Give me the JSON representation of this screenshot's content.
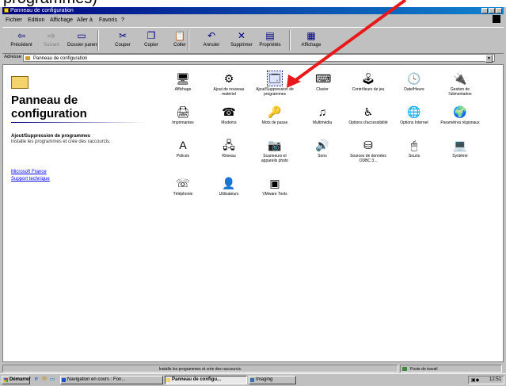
{
  "caption_fragment": "programmes)",
  "window": {
    "title": "Panneau de configuration"
  },
  "menu": [
    "Fichier",
    "Edition",
    "Affichage",
    "Aller à",
    "Favoris",
    "?"
  ],
  "toolbar": [
    {
      "label": "Précédent",
      "icon": "back-arrow-icon",
      "glyph": "⇦"
    },
    {
      "label": "Suivant",
      "icon": "forward-arrow-icon",
      "glyph": "⇨"
    },
    {
      "label": "Dossier parent",
      "icon": "up-folder-icon",
      "glyph": "▭"
    },
    {
      "label": "Couper",
      "icon": "scissors-icon",
      "glyph": "✂"
    },
    {
      "label": "Copier",
      "icon": "copy-icon",
      "glyph": "❐"
    },
    {
      "label": "Coller",
      "icon": "paste-icon",
      "glyph": "📋"
    },
    {
      "label": "Annuler",
      "icon": "undo-icon",
      "glyph": "↶"
    },
    {
      "label": "Supprimer",
      "icon": "delete-icon",
      "glyph": "✕"
    },
    {
      "label": "Propriétés",
      "icon": "properties-icon",
      "glyph": "▤"
    },
    {
      "label": "Affichage",
      "icon": "views-icon",
      "glyph": "▦"
    }
  ],
  "address": {
    "label": "Adresse",
    "value": "Panneau de configuration"
  },
  "left_pane": {
    "title": "Panneau de configuration",
    "selected_heading": "Ajout/Suppression de programmes",
    "selected_desc": "Installe les programmes et crée des raccourcis.",
    "links": [
      "Microsoft France",
      "Support technique"
    ]
  },
  "icons": [
    {
      "label": "Affichage",
      "icon": "display-icon",
      "glyph": "🖥"
    },
    {
      "label": "Ajout de nouveau matériel",
      "icon": "add-hardware-icon",
      "glyph": "⚙"
    },
    {
      "label": "Ajout/Suppression de programmes",
      "icon": "add-remove-programs-icon",
      "glyph": "🗔",
      "selected": true
    },
    {
      "label": "Clavier",
      "icon": "keyboard-icon",
      "glyph": "⌨"
    },
    {
      "label": "Contrôleurs de jeu",
      "icon": "game-controllers-icon",
      "glyph": "🕹"
    },
    {
      "label": "Date/Heure",
      "icon": "date-time-icon",
      "glyph": "🕓"
    },
    {
      "label": "Gestion de l'alimentation",
      "icon": "power-management-icon",
      "glyph": "🔌"
    },
    {
      "label": "Imprimantes",
      "icon": "printers-icon",
      "glyph": "🖨"
    },
    {
      "label": "Modems",
      "icon": "modems-icon",
      "glyph": "☎"
    },
    {
      "label": "Mots de passe",
      "icon": "passwords-icon",
      "glyph": "🔑"
    },
    {
      "label": "Multimédia",
      "icon": "multimedia-icon",
      "glyph": "♫"
    },
    {
      "label": "Options d'accessibilité",
      "icon": "accessibility-icon",
      "glyph": "♿"
    },
    {
      "label": "Options Internet",
      "icon": "internet-options-icon",
      "glyph": "🌐"
    },
    {
      "label": "Paramètres régionaux",
      "icon": "regional-settings-icon",
      "glyph": "🌍"
    },
    {
      "label": "Polices",
      "icon": "fonts-icon",
      "glyph": "A"
    },
    {
      "label": "Réseau",
      "icon": "network-icon",
      "glyph": "🖧"
    },
    {
      "label": "Scanneurs et appareils photo",
      "icon": "scanners-cameras-icon",
      "glyph": "📷"
    },
    {
      "label": "Sons",
      "icon": "sounds-icon",
      "glyph": "🔊"
    },
    {
      "label": "Sources de données ODBC 3...",
      "icon": "odbc-icon",
      "glyph": "⛁"
    },
    {
      "label": "Souris",
      "icon": "mouse-icon",
      "glyph": "🖱"
    },
    {
      "label": "Système",
      "icon": "system-icon",
      "glyph": "💻"
    },
    {
      "label": "Téléphonie",
      "icon": "telephony-icon",
      "glyph": "☏"
    },
    {
      "label": "Utilisateurs",
      "icon": "users-icon",
      "glyph": "👤"
    },
    {
      "label": "VMware Tools",
      "icon": "vmware-tools-icon",
      "glyph": "▣"
    }
  ],
  "status": {
    "left": "Installe les programmes et crée des raccourcis.",
    "right": "Poste de travail"
  },
  "taskbar": {
    "start": "Démarrer",
    "tasks": [
      {
        "label": "Navigation en cours : Fon...",
        "icon": "ie-icon"
      },
      {
        "label": "Panneau de configu...",
        "icon": "folder-icon",
        "active": true
      },
      {
        "label": "Imaging",
        "icon": "imaging-icon"
      }
    ],
    "clock": "12:51"
  },
  "colors": {
    "title_bar": "#000080",
    "arrow": "#e8191a",
    "link": "#0000ff"
  }
}
